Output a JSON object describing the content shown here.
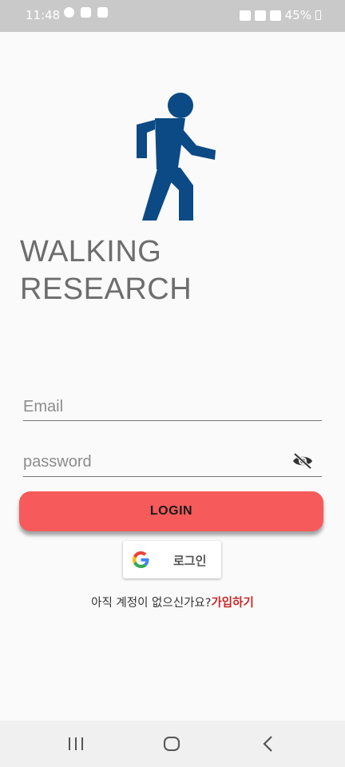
{
  "status_bar": {
    "time": "11:48",
    "battery": "45%",
    "icons_left": [
      "chat-icon",
      "photo-icon",
      "app-icon"
    ],
    "icons_right": [
      "mute-icon",
      "wifi-icon",
      "hd-icon",
      "signal-icon",
      "battery-icon"
    ]
  },
  "app": {
    "logo_icon": "walking-person-icon",
    "logo_color": "#0b4a85",
    "title_line1": "WALKING",
    "title_line2": "RESEARCH"
  },
  "form": {
    "email_placeholder": "Email",
    "email_value": "",
    "password_placeholder": "password",
    "password_value": "",
    "password_toggle_icon": "eye-off-icon",
    "login_label": "LOGIN",
    "login_color": "#f65a5a"
  },
  "google": {
    "icon": "google-g-icon",
    "label": "로그인"
  },
  "signup": {
    "prompt": "아직 계정이 없으신가요?",
    "link": "가입하기",
    "link_color": "#c62828"
  },
  "nav": {
    "recent_icon": "recent-apps-icon",
    "home_icon": "home-icon",
    "back_icon": "back-icon"
  }
}
